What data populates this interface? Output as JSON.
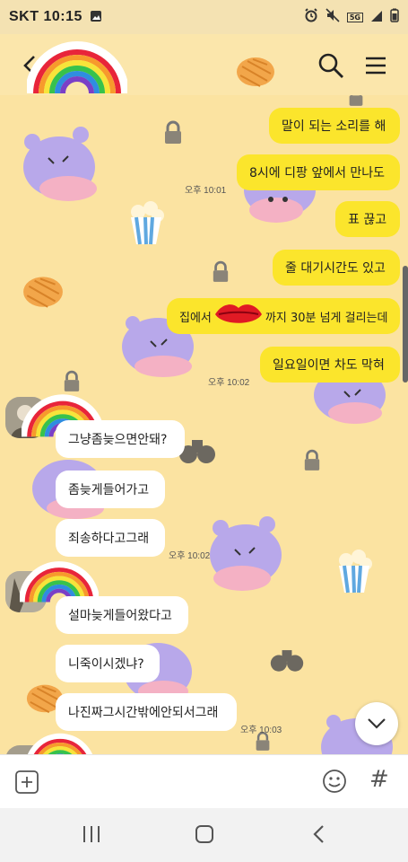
{
  "status_bar": {
    "carrier_time": "SKT 10:15",
    "signal_label": "5G"
  },
  "header": {
    "title": ""
  },
  "chat": {
    "messages_out": [
      {
        "text": "말이 되는 소리를 해"
      },
      {
        "text": "8시에 디팡 앞에서 만나도"
      },
      {
        "text": "표 끊고"
      },
      {
        "text": "줄 대기시간도 있고"
      },
      {
        "text_before": "집에서",
        "text_after": "까지 30분 넘게 걸리는데"
      },
      {
        "text": "일요일이면 차도 막혀"
      }
    ],
    "timestamps_out": [
      "오후 10:01",
      "오후 10:02"
    ],
    "messages_in_group1": [
      {
        "text": "그냥좀늦으면안돼?"
      },
      {
        "text": "좀늦게들어가고"
      },
      {
        "text": "죄송하다고그래"
      }
    ],
    "timestamp_in1": "오후 10:02",
    "messages_in_group2": [
      {
        "text": "설마늦게들어왔다고"
      },
      {
        "text": "니죽이시겠냐?"
      },
      {
        "text": "나진짜그시간밖에안되서그래"
      }
    ],
    "timestamp_in2": "오후 10:03"
  },
  "input_bar": {
    "hash_label": "#"
  },
  "colors": {
    "outgoing_bubble": "#fbe52c",
    "incoming_bubble": "#ffffff",
    "background": "#fbe3a1"
  }
}
